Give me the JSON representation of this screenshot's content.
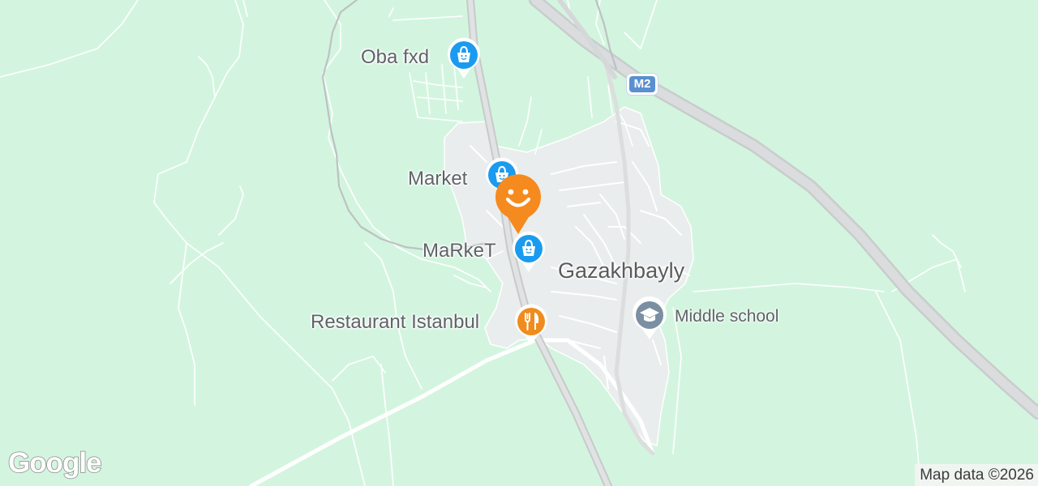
{
  "map": {
    "town": "Gazakhbayly",
    "highway_shield": "M2",
    "pois": [
      {
        "name": "Oba fxd",
        "category": "shopping",
        "icon": "shopping-bag-icon",
        "color": "#1a9bf0"
      },
      {
        "name": "Market",
        "category": "shopping",
        "icon": "shopping-bag-icon",
        "color": "#1a9bf0"
      },
      {
        "name": "MaRkeT",
        "category": "shopping",
        "icon": "shopping-bag-icon",
        "color": "#1a9bf0"
      },
      {
        "name": "Restaurant Istanbul",
        "category": "restaurant",
        "icon": "fork-knife-icon",
        "color": "#f08c1e"
      },
      {
        "name": "Middle school",
        "category": "school",
        "icon": "graduation-cap-icon",
        "color": "#7b8fa3"
      }
    ],
    "selected_marker": {
      "icon": "smiley-icon",
      "color": "#f58a1f"
    }
  },
  "colors": {
    "land": "#d3f5df",
    "urban": "#eaeded",
    "road": "#ffffff",
    "highway": "#d7dadb"
  },
  "branding": {
    "logo": "Google",
    "attribution": "Map data ©2026"
  }
}
